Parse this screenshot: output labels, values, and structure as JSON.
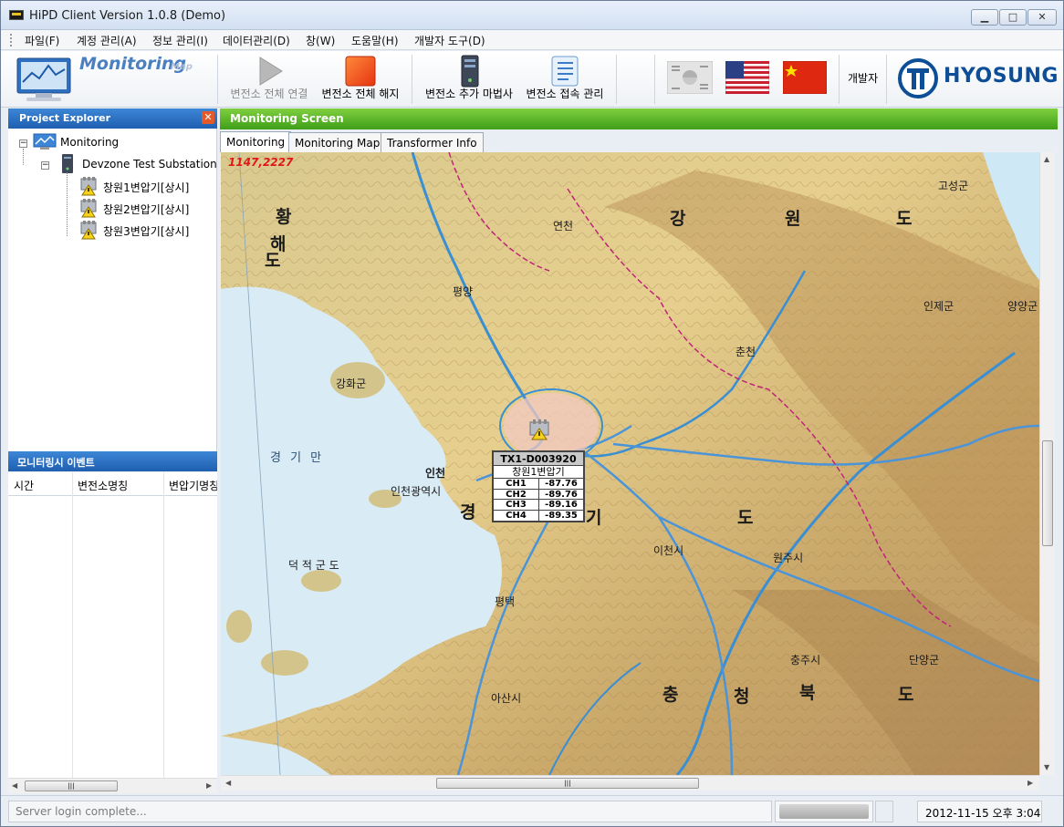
{
  "window": {
    "title": "HiPD Client Version 1.0.8 (Demo)",
    "controls": {
      "minimize": "▁",
      "maximize": "□",
      "close": "✕"
    }
  },
  "menu": {
    "items": [
      "파일(F)",
      "계정 관리(A)",
      "정보 관리(I)",
      "데이터관리(D)",
      "창(W)",
      "도움말(H)",
      "개발자 도구(D)"
    ]
  },
  "toolbar": {
    "title": "Monitoring",
    "subtitle": "Map",
    "buttons": [
      {
        "label": "변전소 전체 연결",
        "icon": "play-icon",
        "enabled": false
      },
      {
        "label": "변전소 전체 해지",
        "icon": "stop-icon",
        "enabled": true
      },
      {
        "label": "변전소 추가 마법사",
        "icon": "server-icon",
        "enabled": true
      },
      {
        "label": "변전소 접속 관리",
        "icon": "list-manage-icon",
        "enabled": true
      }
    ],
    "languages": [
      "korea-flag-icon",
      "usa-flag-icon",
      "china-flag-icon"
    ],
    "developer_label": "개발자",
    "brand": "HYOSUNG"
  },
  "project_explorer": {
    "title": "Project Explorer",
    "root": "Monitoring",
    "substation": "Devzone Test Substation",
    "transformers": [
      "창원1변압기[상시]",
      "창원2변압기[상시]",
      "창원3변압기[상시]"
    ]
  },
  "event_panel": {
    "title": "모니터링시 이벤트",
    "columns": [
      "시간",
      "변전소명칭",
      "변압기명칭"
    ]
  },
  "monitoring_screen": {
    "title": "Monitoring Screen",
    "tabs": [
      "Monitoring",
      "Monitoring Map",
      "Transformer Info"
    ],
    "active_tab": 0
  },
  "map": {
    "coordinates": "1147,2227",
    "regions": [
      "강",
      "원",
      "도",
      "경",
      "기",
      "도",
      "충",
      "청",
      "북",
      "도",
      "황",
      "해",
      "도"
    ],
    "places": [
      "인천",
      "인천광역시",
      "강화군",
      "고성군",
      "인제군",
      "춘천",
      "원주시",
      "이천시",
      "충주시",
      "단양군",
      "평택",
      "아산시",
      "연천",
      "평양",
      "양양군",
      "경 기 만",
      "덕 적 군 도"
    ]
  },
  "popup": {
    "id": "TX1-D003920",
    "name": "창원1변압기",
    "channels": [
      {
        "ch": "CH1",
        "value": "-87.76"
      },
      {
        "ch": "CH2",
        "value": "-89.76"
      },
      {
        "ch": "CH3",
        "value": "-89.16"
      },
      {
        "ch": "CH4",
        "value": "-89.35"
      }
    ]
  },
  "status": {
    "message": "Server login complete...",
    "datetime": "2012-11-15 오후 3:04"
  },
  "colors": {
    "panel_header_blue": "#2f74c8",
    "panel_header_green": "#5cb82b",
    "brand": "#0d4e96",
    "coord_red": "#e01818"
  }
}
